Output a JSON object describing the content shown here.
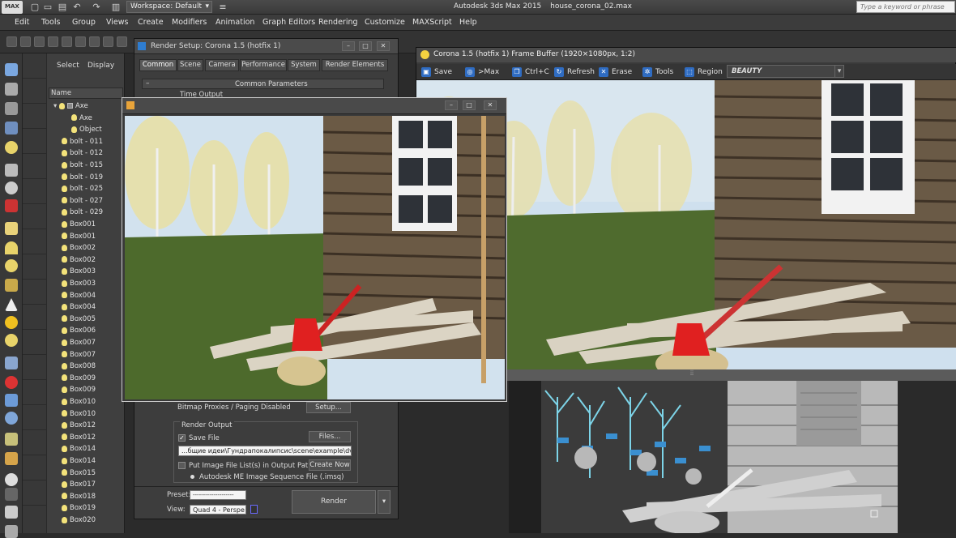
{
  "titlebar": {
    "app_logo": "MAX",
    "workspace": "Workspace: Default",
    "app_title": "Autodesk 3ds Max  2015",
    "file_name": "house_corona_02.max",
    "search_placeholder": "Type a keyword or phrase"
  },
  "menubar": {
    "items": [
      "Edit",
      "Tools",
      "Group",
      "Views",
      "Create",
      "Modifiers",
      "Animation",
      "Graph Editors",
      "Rendering",
      "Customize",
      "MAXScript",
      "Help"
    ]
  },
  "scene_explorer": {
    "tabs": [
      "Select",
      "Display"
    ],
    "column": "Name",
    "rows": [
      "Axe",
      "Axe",
      "Object",
      "bolt - 011",
      "bolt - 012",
      "bolt - 015",
      "bolt - 019",
      "bolt - 025",
      "bolt - 027",
      "bolt - 029",
      "Box001",
      "Box001",
      "Box002",
      "Box002",
      "Box003",
      "Box003",
      "Box004",
      "Box004",
      "Box005",
      "Box006",
      "Box007",
      "Box007",
      "Box008",
      "Box009",
      "Box009",
      "Box010",
      "Box010",
      "Box012",
      "Box012",
      "Box014",
      "Box014",
      "Box015",
      "Box017",
      "Box018",
      "Box019",
      "Box020"
    ]
  },
  "render_setup": {
    "title": "Render Setup: Corona 1.5 (hotfix 1)",
    "tabs": [
      "Common",
      "Scene",
      "Camera",
      "Performance",
      "System",
      "Render Elements"
    ],
    "rollout": "Common Parameters",
    "time_output": "Time Output",
    "bitmap_proxies": "Bitmap Proxies / Paging Disabled",
    "setup_button": "Setup...",
    "render_output": "Render Output",
    "save_file": "Save File",
    "files_button": "Files...",
    "output_path": "...бщие идеи\\Гундрапокалипсис\\scene\\example\\dvor.avi",
    "put_image": "Put Image File List(s) in Output Path(s)",
    "create_now": "Create Now",
    "autodesk_seq": "Autodesk ME Image Sequence File (.imsq)",
    "preset_label": "Preset:",
    "preset_value": "--------------------",
    "view_label": "View:",
    "view_value": "Quad 4 - Perspe",
    "render_button": "Render"
  },
  "frame_buffer": {
    "title": "Corona 1.5 (hotfix 1) Frame Buffer (1920×1080px, 1:2)",
    "tools": [
      "Save",
      ">Max",
      "Ctrl+C",
      "Refresh",
      "Erase",
      "Tools",
      "Region"
    ],
    "channel": "BEAUTY"
  }
}
